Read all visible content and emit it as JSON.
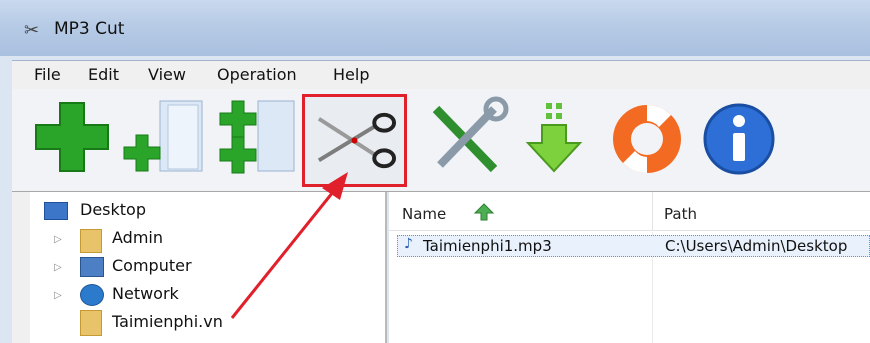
{
  "window": {
    "title": "MP3 Cut",
    "icon": "scissors-icon"
  },
  "menu": [
    "File",
    "Edit",
    "View",
    "Operation",
    "Help"
  ],
  "toolbar": [
    {
      "name": "add-file",
      "icon": "green-plus-icon"
    },
    {
      "name": "add-folder",
      "icon": "add-folder-icon"
    },
    {
      "name": "add-multiple",
      "icon": "add-multiple-icon"
    },
    {
      "name": "cut",
      "icon": "scissors-icon",
      "highlighted": true
    },
    {
      "name": "settings",
      "icon": "tools-icon"
    },
    {
      "name": "download",
      "icon": "download-arrow-icon"
    },
    {
      "name": "help",
      "icon": "lifebuoy-icon"
    },
    {
      "name": "about",
      "icon": "info-icon"
    }
  ],
  "tree": {
    "root": "Desktop",
    "children": [
      "Admin",
      "Computer",
      "Network",
      "Taimienphi.vn"
    ]
  },
  "list": {
    "columns": [
      "Name",
      "Path"
    ],
    "rows": [
      {
        "name": "Taimienphi1.mp3",
        "path": "C:\\Users\\Admin\\Desktop"
      }
    ]
  },
  "colors": {
    "highlight": "#e0202a",
    "selection": "#e8f1fc"
  }
}
